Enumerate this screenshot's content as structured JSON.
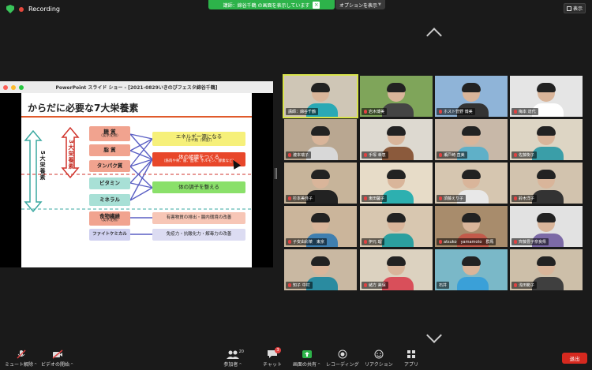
{
  "top": {
    "recording_label": "Recording",
    "share_banner": "講師：綿谷千鶴 の画面を表示しています",
    "share_close": "×",
    "options_label": "オプションを表示",
    "view_label": "表示"
  },
  "ppt": {
    "window_title": "PowerPoint スライド ショー - [2021-0829いきのびフェスタ綿谷千鶴]",
    "slide_title": "からだに必要な7大栄養素",
    "label_5": "5大栄養素",
    "label_3": "3大栄養素",
    "nutrients": [
      {
        "main": "糖 質",
        "sub": "（炭水化物）"
      },
      {
        "main": "脂 質",
        "sub": ""
      },
      {
        "main": "タンパク質",
        "sub": ""
      },
      {
        "main": "ビタミン",
        "sub": ""
      },
      {
        "main": "ミネラル",
        "sub": ""
      },
      {
        "main": "食物繊維",
        "sub": "（炭水化物）"
      },
      {
        "main": "ファイトケミカル",
        "sub": ""
      }
    ],
    "roles": [
      {
        "main": "エネルギー源になる",
        "sub": "（カや熱（体温））"
      },
      {
        "main": "体の組織をつくる",
        "sub": "（筋肉や骨、歯、血液、ホルモン、酵素など）"
      },
      {
        "main": "体の調子を整える",
        "sub": ""
      },
      {
        "main": "有害物質の排出・腸内環境の改善",
        "sub": ""
      },
      {
        "main": "免疫力・抗酸化力・解毒力の改善",
        "sub": ""
      }
    ]
  },
  "participants": [
    {
      "name": "講師：綿谷千鶴",
      "muted": false
    },
    {
      "name": "岩木博美",
      "muted": true
    },
    {
      "name": "ホスト菅野 博美",
      "muted": true
    },
    {
      "name": "梅本 達代",
      "muted": true
    },
    {
      "name": "瀧本瑞子",
      "muted": true
    },
    {
      "name": "手塚 幸恵",
      "muted": true
    },
    {
      "name": "瀬戸崎 直美",
      "muted": true
    },
    {
      "name": "佐藤衡子",
      "muted": true
    },
    {
      "name": "杉本美佳子",
      "muted": true
    },
    {
      "name": "東田馨子",
      "muted": true
    },
    {
      "name": "須藤えり子",
      "muted": true
    },
    {
      "name": "鈴木洋子",
      "muted": true
    },
    {
      "name": "子安由彩菜　東京",
      "muted": true
    },
    {
      "name": "伊元 瑠",
      "muted": true
    },
    {
      "name": "atsuko　yamamoto　群馬",
      "muted": true
    },
    {
      "name": "齊藤豊子奈良県",
      "muted": true
    },
    {
      "name": "知子 中村",
      "muted": true
    },
    {
      "name": "緒方 美保",
      "muted": true
    },
    {
      "name": "石井",
      "muted": false
    },
    {
      "name": "浅田範子",
      "muted": true
    }
  ],
  "toolbar": {
    "mute": "ミュート解除",
    "video": "ビデオの開始",
    "participants": "参加者",
    "participants_count": "20",
    "chat": "チャット",
    "chat_badge": "3",
    "share": "画面の共有",
    "record": "レコーディング",
    "reactions": "リアクション",
    "apps": "アプリ",
    "leave": "退出"
  },
  "colors": {
    "green": "#2db34a",
    "red": "#d6291f",
    "active_border": "#d8e34a"
  }
}
